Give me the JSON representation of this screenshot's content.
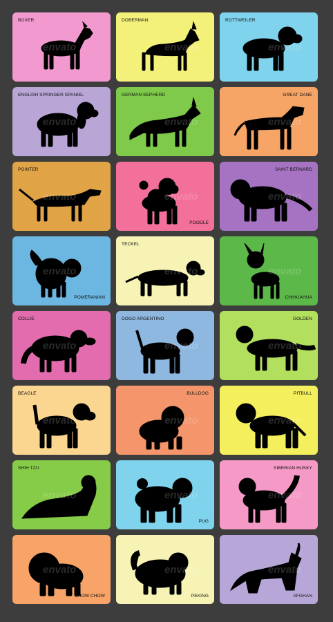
{
  "watermark": "envato",
  "cards": [
    {
      "name": "BOXER",
      "label_pos": "tl",
      "color": "#f29ad0",
      "pose": "boxer"
    },
    {
      "name": "DOBERMAN",
      "label_pos": "tl",
      "color": "#f4f17a",
      "pose": "doberman"
    },
    {
      "name": "ROTTWEILER",
      "label_pos": "tl",
      "color": "#7fd3ec",
      "pose": "rott"
    },
    {
      "name": "ENGLISH SPRINGER SPANIEL",
      "label_pos": "tl",
      "color": "#b9a6d6",
      "pose": "spaniel"
    },
    {
      "name": "GERMAN SEPHERD",
      "label_pos": "tl",
      "color": "#7fca4a",
      "pose": "shepherd"
    },
    {
      "name": "GREAT DANE",
      "label_pos": "tr",
      "color": "#f7a566",
      "pose": "dane"
    },
    {
      "name": "POINTER",
      "label_pos": "tl",
      "color": "#e0a345",
      "pose": "pointer"
    },
    {
      "name": "POODLE",
      "label_pos": "br",
      "color": "#f3709a",
      "pose": "poodle"
    },
    {
      "name": "SAINT BERNARD",
      "label_pos": "tr",
      "color": "#a573c2",
      "pose": "bernard"
    },
    {
      "name": "POMERANIAN",
      "label_pos": "br",
      "color": "#6cb6e2",
      "pose": "pom"
    },
    {
      "name": "TECKEL",
      "label_pos": "tl",
      "color": "#f6f3b4",
      "pose": "teckel"
    },
    {
      "name": "CHIHUAHUA",
      "label_pos": "br",
      "color": "#5db84a",
      "pose": "chi"
    },
    {
      "name": "COLLIE",
      "label_pos": "tl",
      "color": "#e36cae",
      "pose": "collie"
    },
    {
      "name": "DOGO ARGENTINO",
      "label_pos": "tl",
      "color": "#8fb8e0",
      "pose": "dogo"
    },
    {
      "name": "GOLDEN",
      "label_pos": "tr",
      "color": "#b3df5e",
      "pose": "golden"
    },
    {
      "name": "BEAGLE",
      "label_pos": "tl",
      "color": "#fbd691",
      "pose": "beagle"
    },
    {
      "name": "BULLDOG",
      "label_pos": "tr",
      "color": "#f5956c",
      "pose": "bulldog"
    },
    {
      "name": "PITBULL",
      "label_pos": "tr",
      "color": "#f4ef5c",
      "pose": "pitbull"
    },
    {
      "name": "SHIH TZU",
      "label_pos": "tl",
      "color": "#86cc48",
      "pose": "shihtzu"
    },
    {
      "name": "PUG",
      "label_pos": "br",
      "color": "#7fd3ec",
      "pose": "pug"
    },
    {
      "name": "SIBERIAN HUSKY",
      "label_pos": "tr",
      "color": "#f59ac6",
      "pose": "husky"
    },
    {
      "name": "CHOW CHOW",
      "label_pos": "br",
      "color": "#f8a367",
      "pose": "chow"
    },
    {
      "name": "PEKING",
      "label_pos": "br",
      "color": "#f6f3b4",
      "pose": "peking"
    },
    {
      "name": "AFGHAN",
      "label_pos": "br",
      "color": "#b7a7d8",
      "pose": "afghan"
    }
  ]
}
